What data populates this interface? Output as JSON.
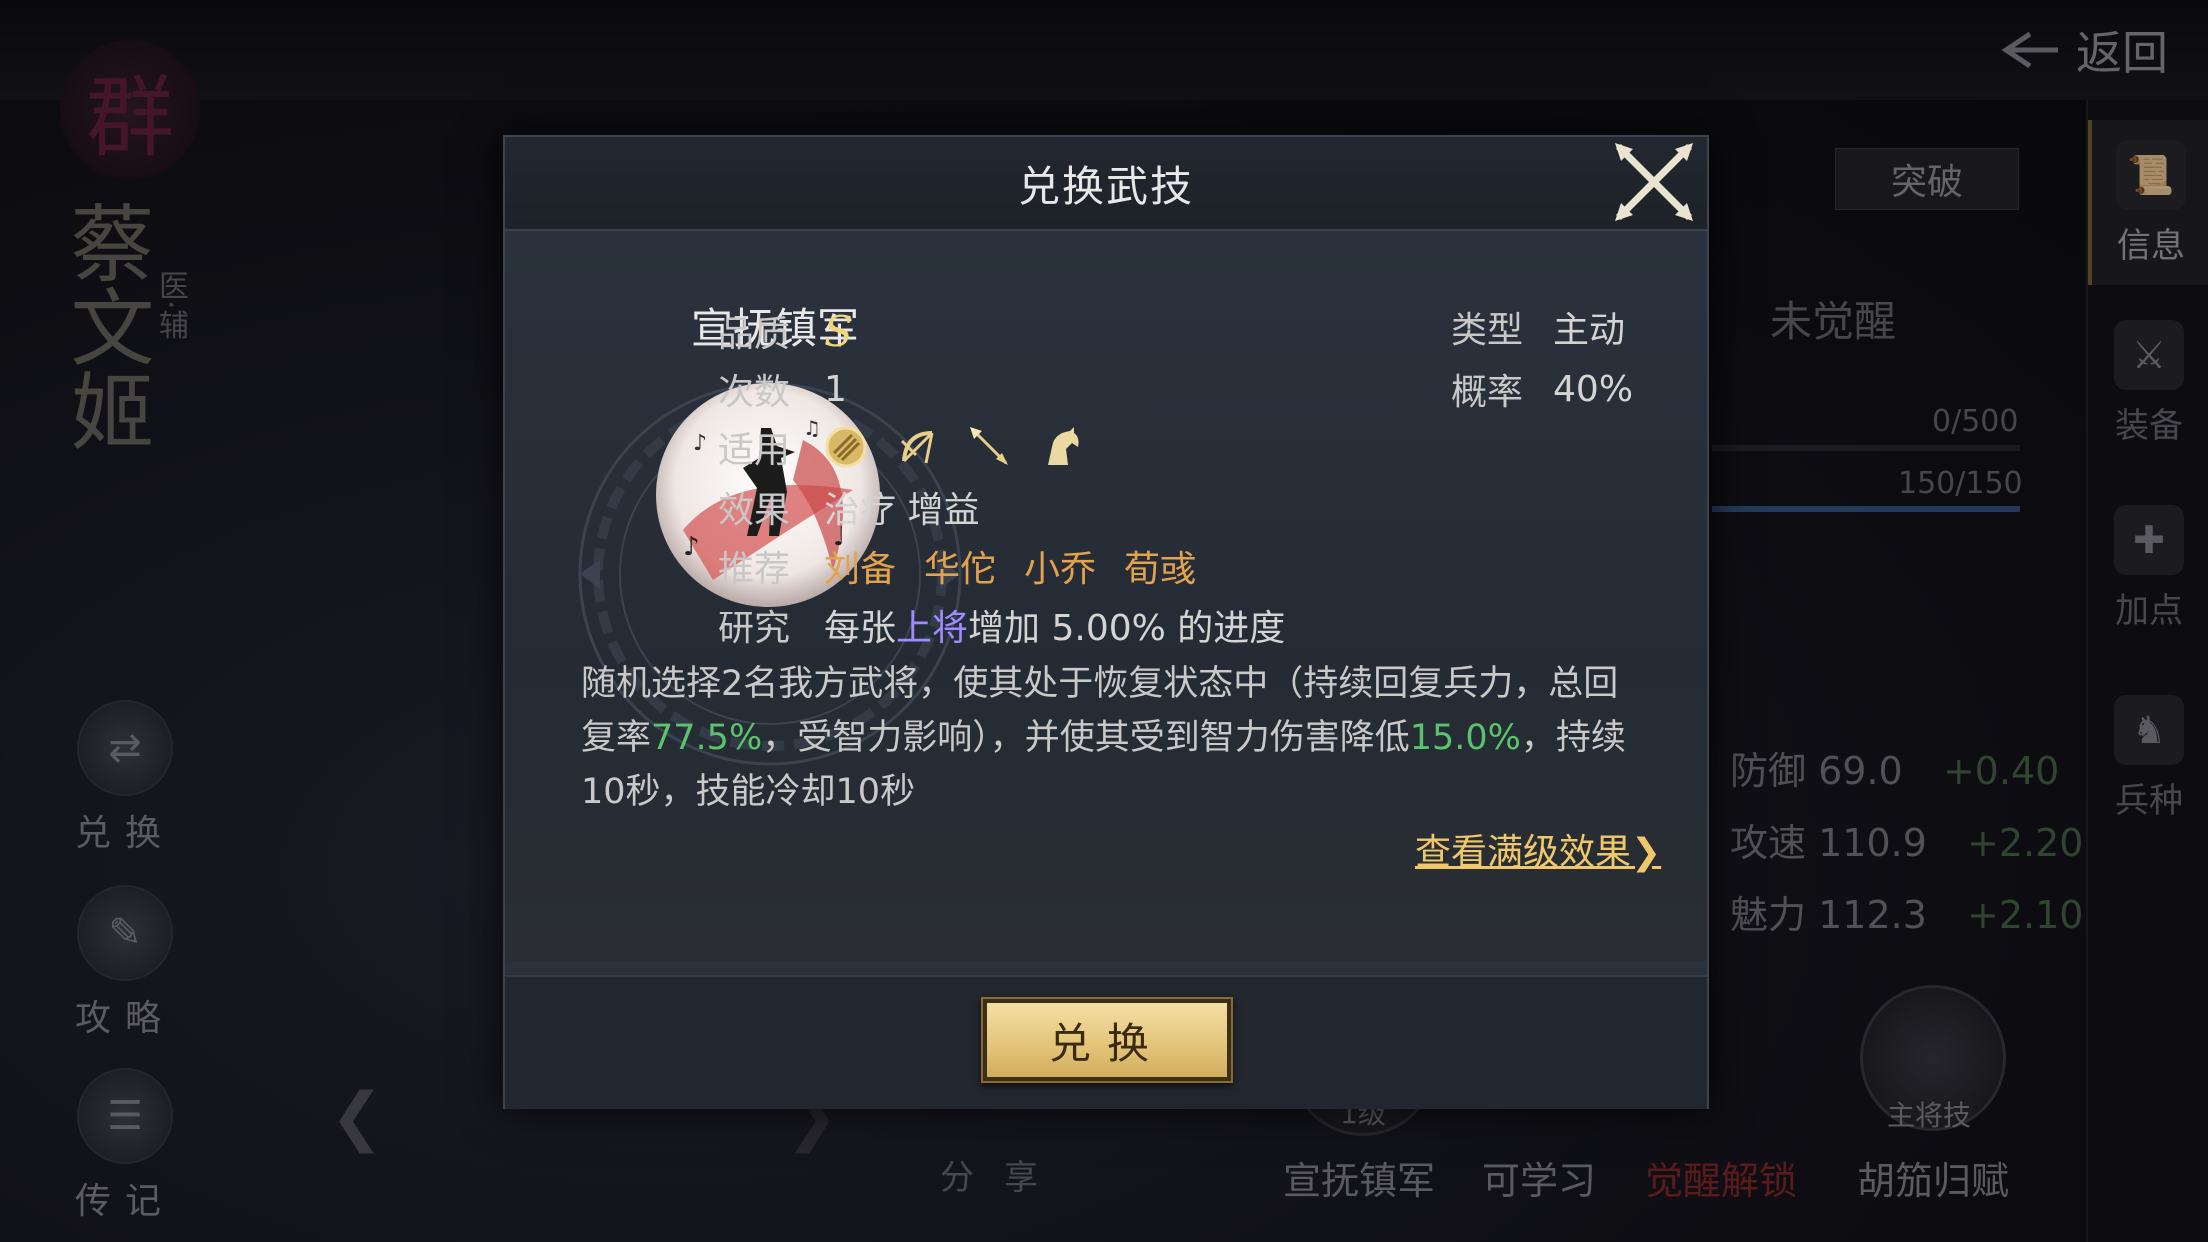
{
  "header": {
    "back_label": "返回"
  },
  "hero": {
    "faction": "群",
    "name": "蔡文姬",
    "role": "医·辅"
  },
  "left_menu": [
    {
      "label": "兑换",
      "icon": "exchange-icon"
    },
    {
      "label": "攻略",
      "icon": "scroll-icon"
    },
    {
      "label": "传记",
      "icon": "book-icon"
    }
  ],
  "share_label": "分享",
  "right_panel": {
    "breakthrough_label": "突破",
    "awaken_status": "未觉醒",
    "bar1": "0/500",
    "bar2": "150/150",
    "stats": [
      {
        "name": "防御",
        "value": "69.0",
        "plus": "+0.40"
      },
      {
        "name": "攻速",
        "value": "110.9",
        "plus": "+2.20"
      },
      {
        "name": "魅力",
        "value": "112.3",
        "plus": "+2.10"
      }
    ]
  },
  "side_tabs": [
    {
      "label": "信息",
      "icon": "scroll-icon"
    },
    {
      "label": "装备",
      "icon": "equipment-icon"
    },
    {
      "label": "加点",
      "icon": "add-point-icon"
    },
    {
      "label": "兵种",
      "icon": "unit-icon"
    }
  ],
  "bottom_skills": [
    {
      "label": "宣抚镇军",
      "badge": "1级"
    },
    {
      "label": "可学习"
    },
    {
      "label": "觉醒解锁"
    },
    {
      "label": "胡笳归赋",
      "badge": "主将技"
    }
  ],
  "dialog": {
    "title": "兑换武技",
    "skill_name": "宣抚镇军",
    "quality_label": "品质",
    "quality_value": "S",
    "type_label": "类型",
    "type_value": "主动",
    "count_label": "次数",
    "count_value": "1",
    "rate_label": "概率",
    "rate_value": "40%",
    "apply_label": "适用",
    "apply_icons": [
      "shield-icon",
      "bow-icon",
      "spear-icon",
      "horse-icon"
    ],
    "effect_label": "效果",
    "effect_value": "治疗 增益",
    "recommend_label": "推荐",
    "recommend": [
      "刘备",
      "华佗",
      "小乔",
      "荀彧"
    ],
    "research_label": "研究",
    "research_pre": "每张",
    "research_hl": "上将",
    "research_post": "增加 5.00% 的进度",
    "desc_1": "随机选择2名我方武将，使其处于恢复状态中（持续回复兵力，总回复率",
    "desc_hl1": "77.5%",
    "desc_2": "，受智力影响），并使其受到智力伤害降低",
    "desc_hl2": "15.0%",
    "desc_3": "，持续10秒，技能冷却10秒",
    "max_link": "查看满级效果",
    "max_arrow": "❯",
    "exchange_label": "兑换"
  },
  "colors": {
    "gold": "#f0c86b",
    "green": "#59c46b",
    "orange": "#e3a24e",
    "purple": "#9e8cff"
  }
}
